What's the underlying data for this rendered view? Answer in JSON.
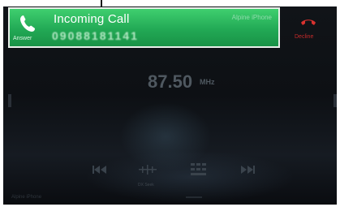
{
  "incoming_call": {
    "title": "Incoming Call",
    "caller_number": "09088181141",
    "device_name": "Alpine iPhone",
    "answer_label": "Answer",
    "decline_label": "Decline"
  },
  "radio": {
    "frequency": "87.50",
    "unit": "MHz",
    "dx_label": "DX Seek"
  },
  "footer": {
    "device_name": "Alpine iPhone"
  },
  "colors": {
    "banner_green": "#22a955",
    "decline_red": "#c42a2a"
  },
  "icons": {
    "answer": "phone-answer-icon",
    "decline": "phone-decline-icon",
    "prev": "skip-back-icon",
    "seek": "dx-seek-icon",
    "preset": "preset-grid-icon",
    "next": "skip-forward-icon"
  }
}
